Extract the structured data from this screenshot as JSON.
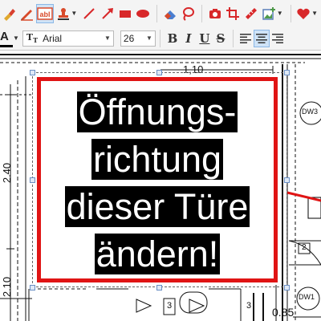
{
  "toolbar_primary": {
    "tools": [
      {
        "name": "highlight-tool",
        "icon": "highlighter-icon"
      },
      {
        "name": "pen-tool",
        "icon": "pen-icon"
      },
      {
        "name": "textbox-tool",
        "icon": "textbox-icon",
        "label": "abl",
        "active": true
      },
      {
        "name": "stamp-tool",
        "icon": "stamp-icon"
      },
      {
        "name": "line-tool",
        "icon": "line-icon"
      },
      {
        "name": "arrow-tool",
        "icon": "arrow-icon"
      },
      {
        "name": "rectangle-tool",
        "icon": "rectangle-icon"
      },
      {
        "name": "ellipse-tool",
        "icon": "ellipse-icon"
      },
      {
        "name": "eraser-tool",
        "icon": "eraser-icon"
      },
      {
        "name": "lasso-tool",
        "icon": "lasso-icon"
      },
      {
        "name": "snapshot-tool",
        "icon": "camera-icon"
      },
      {
        "name": "crop-tool",
        "icon": "crop-icon"
      },
      {
        "name": "measure-tool",
        "icon": "ruler-icon"
      },
      {
        "name": "insert-image-tool",
        "icon": "image-add-icon"
      },
      {
        "name": "favorites-tool",
        "icon": "heart-icon"
      }
    ]
  },
  "toolbar_format": {
    "font_color_label": "A",
    "font_type_icon": "truetype-icon",
    "font_name": "Arial",
    "font_size": "26",
    "bold_label": "B",
    "italic_label": "I",
    "underline_label": "U",
    "strike_label": "S",
    "align": [
      "align-left-icon",
      "align-center-icon",
      "align-right-icon"
    ],
    "active_align": "align-center-icon"
  },
  "drawing": {
    "dimension_top": "1,10",
    "dimension_left_1": "2.40",
    "dimension_left_2": "2.10",
    "dimension_bottom": "0.85",
    "door_tag_1": "DW3",
    "door_tag_2": "DW1",
    "step_tag_1": "3",
    "step_tag_2": "3",
    "step_tag_3": "2",
    "callout_lines": [
      "Öffnungs-",
      "richtung",
      "dieser Türe",
      "ändern!"
    ],
    "callout_border_color": "#e01414"
  }
}
